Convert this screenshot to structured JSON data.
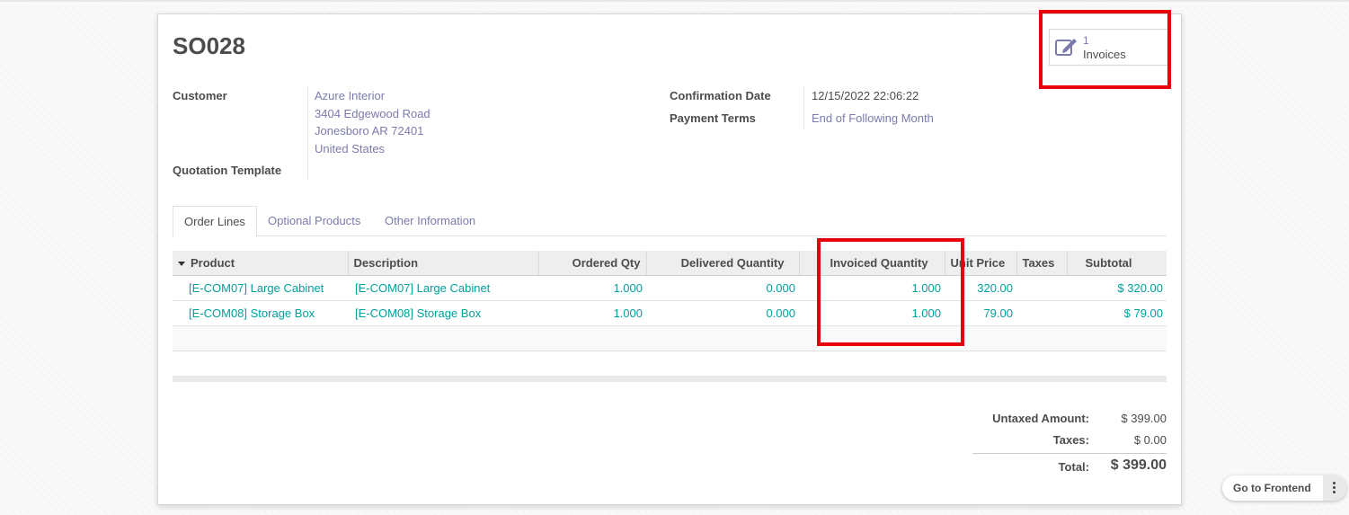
{
  "order": {
    "name": "SO028"
  },
  "smart_button": {
    "count": "1",
    "label": "Invoices",
    "icon": "pencil-square-icon"
  },
  "fields": {
    "customer_label": "Customer",
    "customer_name": "Azure Interior",
    "customer_street": "3404 Edgewood Road",
    "customer_city": "Jonesboro AR 72401",
    "customer_country": "United States",
    "quotation_template_label": "Quotation Template",
    "confirmation_date_label": "Confirmation Date",
    "confirmation_date": "12/15/2022 22:06:22",
    "payment_terms_label": "Payment Terms",
    "payment_terms": "End of Following Month"
  },
  "tabs": [
    {
      "label": "Order Lines",
      "active": true
    },
    {
      "label": "Optional Products",
      "active": false
    },
    {
      "label": "Other Information",
      "active": false
    }
  ],
  "table": {
    "headers": [
      "Product",
      "Description",
      "Ordered Qty",
      "Delivered Quantity",
      "Invoiced Quantity",
      "Unit Price",
      "Taxes",
      "Subtotal"
    ],
    "rows": [
      {
        "product": "[E-COM07] Large Cabinet",
        "description": "[E-COM07] Large Cabinet",
        "ordered": "1.000",
        "delivered": "0.000",
        "invoiced": "1.000",
        "unit_price": "320.00",
        "taxes": "",
        "subtotal": "$ 320.00"
      },
      {
        "product": "[E-COM08] Storage Box",
        "description": "[E-COM08] Storage Box",
        "ordered": "1.000",
        "delivered": "0.000",
        "invoiced": "1.000",
        "unit_price": "79.00",
        "taxes": "",
        "subtotal": "$ 79.00"
      }
    ]
  },
  "totals": {
    "untaxed_label": "Untaxed Amount:",
    "untaxed": "$ 399.00",
    "taxes_label": "Taxes:",
    "taxes": "$ 0.00",
    "total_label": "Total:",
    "total": "$ 399.00"
  },
  "frontend": {
    "label": "Go to Frontend"
  },
  "colors": {
    "highlight": "#e8000b",
    "link": "#7c7bad",
    "teal": "#00a09d"
  }
}
